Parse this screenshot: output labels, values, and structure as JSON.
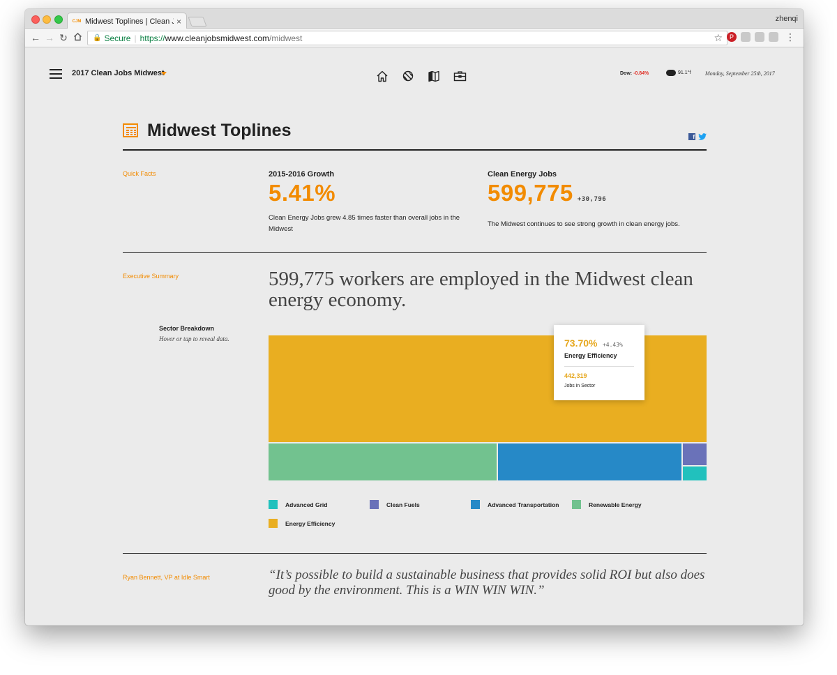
{
  "browser": {
    "tab_title": "Midwest Toplines | Clean Jobs",
    "tab_close": "×",
    "favicon_text": "CJM",
    "user": "zhenqi",
    "secure_label": "Secure",
    "url_scheme": "https://",
    "url_host": "www.cleanjobsmidwest.com",
    "url_path": "/midwest"
  },
  "header": {
    "site_title": "2017 Clean Jobs Midwest",
    "nav_icons": [
      "home-icon",
      "globe-icon",
      "map-icon",
      "briefcase-icon"
    ],
    "dow_label": "Dow:",
    "dow_value": "-0.84%",
    "temperature": "91.1°f",
    "date": "Monday, September 25th, 2017"
  },
  "page": {
    "title": "Midwest Toplines",
    "share": [
      "facebook-icon",
      "twitter-icon"
    ]
  },
  "quick_facts": {
    "label": "Quick Facts",
    "items": [
      {
        "title": "2015-2016 Growth",
        "value": "5.41%",
        "delta": "",
        "description": "Clean Energy Jobs grew 4.85 times faster than overall jobs in the Midwest"
      },
      {
        "title": "Clean Energy Jobs",
        "value": "599,775",
        "delta": "+30,796",
        "description": "The Midwest continues to see strong growth in clean energy jobs."
      }
    ]
  },
  "executive_summary": {
    "label": "Executive Summary",
    "headline": "599,775 workers are employed in the Midwest clean energy economy.",
    "breakdown_title": "Sector Breakdown",
    "breakdown_hint": "Hover or tap to reveal data.",
    "tooltip": {
      "percent": "73.70%",
      "delta": "+4.43%",
      "sector": "Energy Efficiency",
      "jobs": "442,319",
      "jobs_label": "Jobs in Sector"
    }
  },
  "chart_data": {
    "type": "treemap",
    "title": "Sector Breakdown",
    "series": [
      {
        "name": "Energy Efficiency",
        "value": 73.7,
        "jobs": 442319,
        "color": "#e9ae21"
      },
      {
        "name": "Renewable Energy",
        "value": 13.8,
        "color": "#72c28f"
      },
      {
        "name": "Advanced Transportation",
        "value": 11.1,
        "color": "#2689c7"
      },
      {
        "name": "Clean Fuels",
        "value": 0.85,
        "color": "#6a72b9"
      },
      {
        "name": "Advanced Grid",
        "value": 0.55,
        "color": "#21c1bd"
      }
    ],
    "legend": [
      {
        "name": "Advanced Grid",
        "color": "#21c1bd"
      },
      {
        "name": "Clean Fuels",
        "color": "#6a72b9"
      },
      {
        "name": "Advanced Transportation",
        "color": "#2689c7"
      },
      {
        "name": "Renewable Energy",
        "color": "#72c28f"
      },
      {
        "name": "Energy Efficiency",
        "color": "#e9ae21"
      }
    ]
  },
  "quote": {
    "attribution": "Ryan Bennett, VP at Idle Smart",
    "text": "“It’s possible to build a sustainable business that provides solid ROI but also does good by the environment. This is a WIN WIN WIN.”"
  },
  "colors": {
    "accent": "#f28b00",
    "dow_negative": "#e0332a",
    "text": "#222222",
    "page_bg": "#ebebeb"
  }
}
